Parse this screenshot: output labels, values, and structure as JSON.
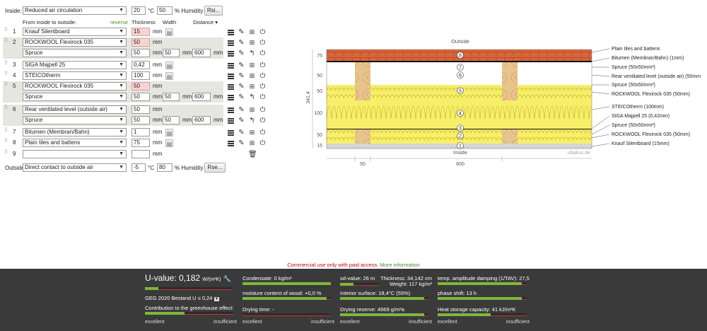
{
  "inside": {
    "label": "Inside:",
    "climate_select": "Reduced air circulation",
    "temperature": "20",
    "temp_unit": "°C",
    "humidity": "50",
    "humidity_unit": "% Humidity",
    "rsi_button": "Rsi..."
  },
  "table_header": {
    "from_label": "From inside to outside:",
    "reverse_link": "reverse",
    "thickness": "Thickness",
    "width": "Width",
    "distance": "Distance"
  },
  "layers": [
    {
      "num": "1",
      "material": "Knauf Silentboard",
      "thickness": "15",
      "unit": "mm",
      "highlight": true
    },
    {
      "num": "2",
      "material": "ROCKWOOL Flexirock 035",
      "thickness": "50",
      "unit": "mm",
      "highlight": true,
      "sub": {
        "material": "Spruce",
        "thickness": "50",
        "width": "50",
        "distance": "600"
      }
    },
    {
      "num": "3",
      "material": "SIGA Majpell 25",
      "thickness": "0,42",
      "unit": "mm"
    },
    {
      "num": "4",
      "material": "STEICOtherm",
      "thickness": "100",
      "unit": "mm"
    },
    {
      "num": "5",
      "material": "ROCKWOOL Flexirock 035",
      "thickness": "50",
      "unit": "mm",
      "highlight": true,
      "sub": {
        "material": "Spruce",
        "thickness": "50",
        "width": "50",
        "distance": "600"
      }
    },
    {
      "num": "6",
      "material": "Rear ventilated level (outside air)",
      "thickness": "50",
      "unit": "mm",
      "sub": {
        "material": "Spruce",
        "thickness": "50",
        "width": "50",
        "distance": "600"
      }
    },
    {
      "num": "7",
      "material": "Bitumen (Membran/Bahn)",
      "thickness": "1",
      "unit": "mm"
    },
    {
      "num": "8",
      "material": "Plain tiles and battens",
      "thickness": "75",
      "unit": "mm"
    },
    {
      "num": "9",
      "material": "",
      "thickness": "",
      "unit": "mm"
    }
  ],
  "mm": "mm",
  "outside": {
    "label": "Outside",
    "climate_select": "Direct contact to outside air",
    "temperature": "-5",
    "temp_unit": "°C",
    "humidity": "80",
    "humidity_unit": "% Humidity",
    "rse_button": "Rse..."
  },
  "diagram": {
    "outside_label": "Outside",
    "inside_label": "Inside",
    "watermark": "ubakus.de",
    "dim_left": [
      "75",
      "50",
      "50",
      "100",
      "50",
      "15"
    ],
    "total_dim": "341,4",
    "bottom_dims": [
      "50",
      "600"
    ],
    "legend": [
      "Plain tiles and battens",
      "Bitumen (Membran/Bahn) (1mm)",
      "Spruce (50x50mm²)",
      "Rear ventilated level (outside air) (50mm",
      "Spruce (50x50mm²)",
      "ROCKWOOL Flexirock 035 (50mm)",
      "STEICOtherm (100mm)",
      "SIGA Majpell 25 (0,42mm)",
      "Spruce (50x50mm²)",
      "ROCKWOOL Flexirock 035 (50mm)",
      "Knauf Silentboard (15mm)"
    ],
    "markers": [
      "8",
      "7",
      "6",
      "5",
      "4",
      "3",
      "2",
      "1"
    ]
  },
  "commercial": {
    "text": "Commercial use only with paid access.",
    "link": "More information"
  },
  "bottom": {
    "uvalue_label": "U-value:",
    "uvalue": "0,182",
    "uvalue_unit": "W/(m²K)",
    "geg": "GEG 2020 Bestand U ≤ 0,24",
    "greenhouse": "Contribution to the greenhouse effect:",
    "condensate": "Condensate: 0 kg/m²",
    "moisture": "moisture content of wood: +0,0 %",
    "drying_time": "Drying time: -",
    "sd_value": "sd-value: 26 m",
    "thickness": "Thickness: 34,142 cm",
    "weight": "Weight: 117 kg/m²",
    "interior_surface": "Interior surface: 18,4°C (55%)",
    "drying_reserve": "Drying reserve: 4669 g/m²a",
    "temp_damping": "temp. amplitude damping (1/TAV): 27,5",
    "phase_shift": "phase shift: 13 h",
    "heat_storage": "Heat storage capacity: 41 kJ/m²K",
    "excellent": "excellent",
    "insufficient": "insufficient",
    "levels": {
      "uvalue": 0.15,
      "greenhouse": 0.45,
      "condensate": 1.0,
      "moisture": 0.95,
      "drying_time": 0.0,
      "sd": 0.35,
      "interior": 0.95,
      "drying_reserve": 0.95,
      "damping": 0.95,
      "phase": 0.95,
      "heat": 0.6
    }
  },
  "colors": {
    "insulation": "#f7ef6a",
    "wood": "#e8c48d",
    "tiles": "#d9653b",
    "board": "#d8d8d8",
    "highlight": "#f7d4d4",
    "good": "#7fb73a",
    "bad": "#cc3333"
  }
}
